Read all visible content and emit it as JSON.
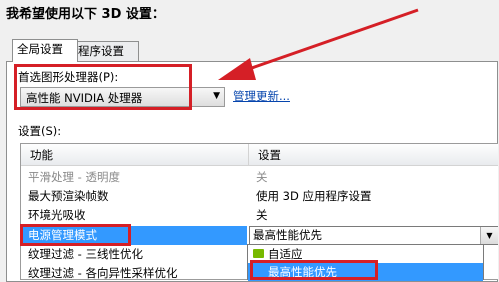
{
  "heading": "我希望使用以下 3D 设置：",
  "tabs": [
    "全局设置",
    "程序设置"
  ],
  "gpu": {
    "label": "首选图形处理器(P):",
    "value": "高性能 NVIDIA 处理器",
    "update_link": "管理更新..."
  },
  "settings_label": "设置(S):",
  "table": {
    "headers": [
      "功能",
      "设置"
    ],
    "rows": [
      {
        "feature": "平滑处理 - 透明度",
        "setting": "关"
      },
      {
        "feature": "最大预渲染帧数",
        "setting": "使用 3D 应用程序设置"
      },
      {
        "feature": "环境光吸收",
        "setting": "关"
      },
      {
        "feature": "电源管理模式",
        "setting": "最高性能优先"
      },
      {
        "feature": "纹理过滤 - 三线性优化",
        "setting": ""
      },
      {
        "feature": "纹理过滤 - 各向异性采样优化",
        "setting": ""
      }
    ]
  },
  "dropdown": {
    "options": [
      "自适应",
      "最高性能优先"
    ],
    "selected": "最高性能优先"
  },
  "colors": {
    "highlight_red": "#d51f26",
    "selection_blue": "#3399ff",
    "nvidia_green": "#77b900"
  }
}
